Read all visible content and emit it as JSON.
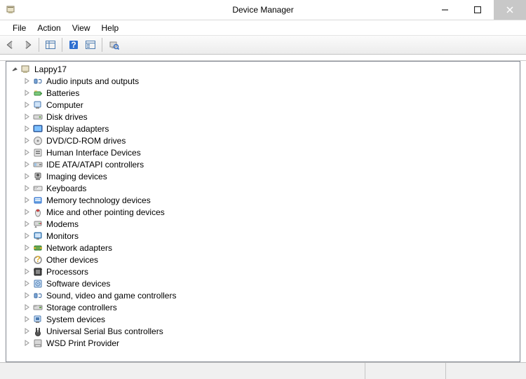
{
  "window": {
    "title": "Device Manager"
  },
  "menu": {
    "file": "File",
    "action": "Action",
    "view": "View",
    "help": "Help"
  },
  "tree": {
    "root": {
      "label": "Lappy17"
    },
    "categories": [
      {
        "label": "Audio inputs and outputs"
      },
      {
        "label": "Batteries"
      },
      {
        "label": "Computer"
      },
      {
        "label": "Disk drives"
      },
      {
        "label": "Display adapters"
      },
      {
        "label": "DVD/CD-ROM drives"
      },
      {
        "label": "Human Interface Devices"
      },
      {
        "label": "IDE ATA/ATAPI controllers"
      },
      {
        "label": "Imaging devices"
      },
      {
        "label": "Keyboards"
      },
      {
        "label": "Memory technology devices"
      },
      {
        "label": "Mice and other pointing devices"
      },
      {
        "label": "Modems"
      },
      {
        "label": "Monitors"
      },
      {
        "label": "Network adapters"
      },
      {
        "label": "Other devices"
      },
      {
        "label": "Processors"
      },
      {
        "label": "Software devices"
      },
      {
        "label": "Sound, video and game controllers"
      },
      {
        "label": "Storage controllers"
      },
      {
        "label": "System devices"
      },
      {
        "label": "Universal Serial Bus controllers"
      },
      {
        "label": "WSD Print Provider"
      }
    ]
  }
}
